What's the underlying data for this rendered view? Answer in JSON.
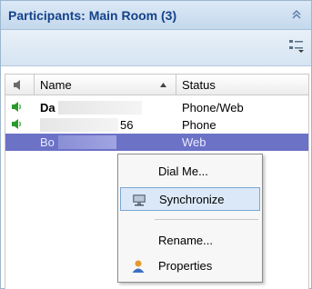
{
  "panel": {
    "title": "Participants: Main Room (3)"
  },
  "grid": {
    "columns": {
      "name": "Name",
      "status": "Status"
    },
    "rows": [
      {
        "name_visible": "Da",
        "status": "Phone/Web"
      },
      {
        "name_visible": "56",
        "status": "Phone"
      },
      {
        "name_visible": "Bo",
        "status": "Web"
      }
    ]
  },
  "context_menu": {
    "items": [
      {
        "label": "Dial Me..."
      },
      {
        "label": "Synchronize"
      },
      {
        "label": "Rename..."
      },
      {
        "label": "Properties"
      }
    ]
  },
  "colors": {
    "title_text": "#15428b",
    "selected_row": "#6c72c6",
    "menu_highlight": "#dbe8f7"
  }
}
